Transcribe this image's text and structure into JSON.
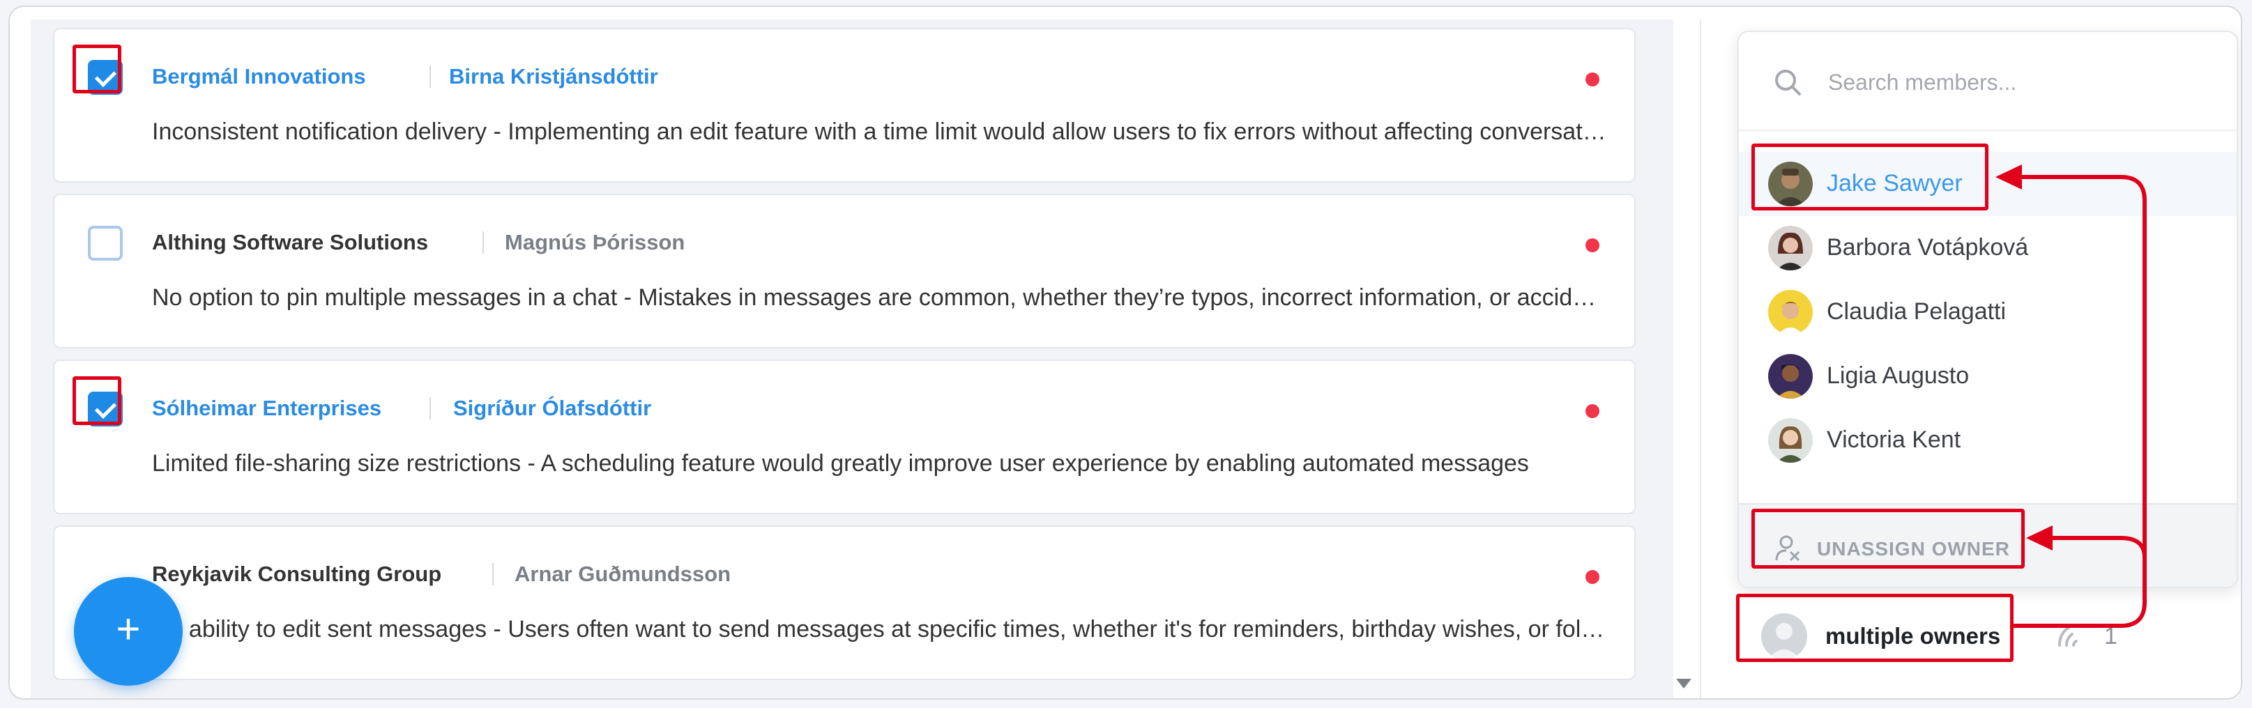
{
  "tickets": [
    {
      "company": "Bergmál Innovations",
      "person": "Birna Kristjánsdóttir",
      "message": "Inconsistent notification delivery - Implementing an edit feature with a time limit would allow users to fix errors without affecting conversation flow",
      "selected": true
    },
    {
      "company": "Althing Software Solutions",
      "person": "Magnús Þórisson",
      "message": "No option to pin multiple messages in a chat - Mistakes in messages are common, whether they’re typos, incorrect information, or accidental sends",
      "selected": false
    },
    {
      "company": "Sólheimar Enterprises",
      "person": "Sigríður Ólafsdóttir",
      "message": "Limited file-sharing size restrictions - A scheduling feature would greatly improve user experience by enabling automated messages",
      "selected": true
    },
    {
      "company": "Reykjavik Consulting Group",
      "person": "Arnar Guðmundsson",
      "message": "No ability to edit sent messages - Users often want to send messages at specific times, whether it's for reminders, birthday wishes, or follow-ups",
      "selected": false
    }
  ],
  "fab": {
    "label": "+"
  },
  "owner_dropdown": {
    "search_placeholder": "Search members...",
    "members": [
      {
        "name": "Jake Sawyer",
        "active": true
      },
      {
        "name": "Barbora Votápková",
        "active": false
      },
      {
        "name": "Claudia Pelagatti",
        "active": false
      },
      {
        "name": "Ligia Augusto",
        "active": false
      },
      {
        "name": "Victoria Kent",
        "active": false
      }
    ],
    "unassign_label": "UNASSIGN OWNER"
  },
  "owner_field": {
    "label": "multiple owners"
  },
  "trail_count": "1",
  "colors": {
    "accent": "#2b8be3",
    "highlight": "#e0001a",
    "unread_dot": "#f0344a",
    "fab": "#1e90f0"
  }
}
